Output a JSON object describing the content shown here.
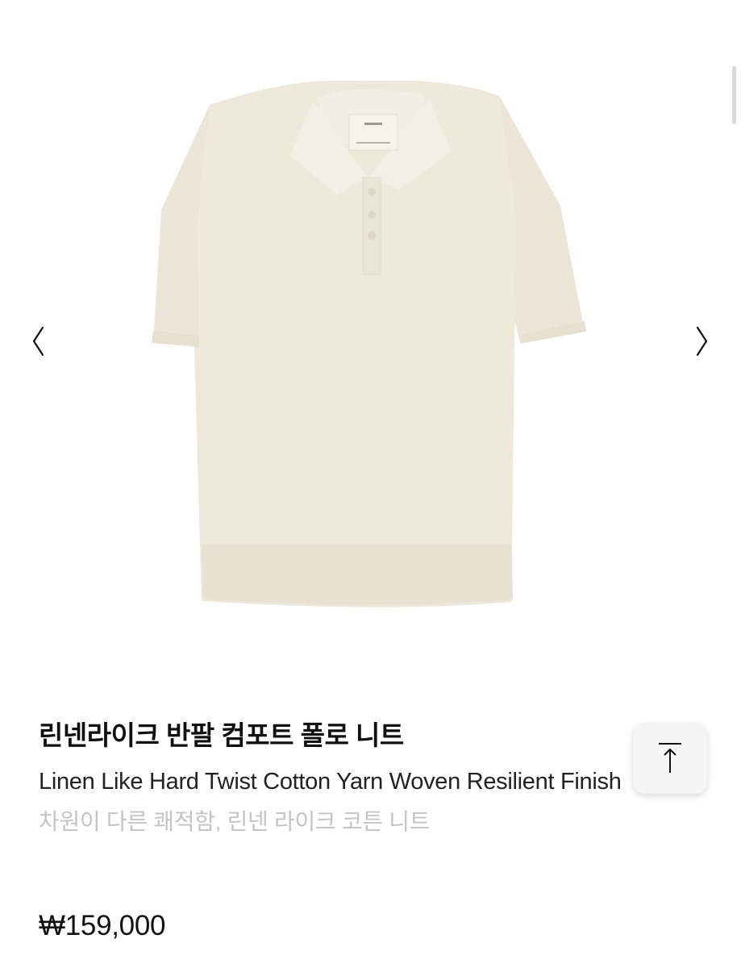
{
  "product": {
    "title_ko": "린넨라이크 반팔 컴포트 폴로 니트",
    "title_en": "Linen Like Hard Twist Cotton Yarn Woven Resilient Finish",
    "subtitle": "차원이 다른 쾌적함, 린넨 라이크 코튼 니트",
    "price": "₩159,000"
  },
  "icons": {
    "prev": "chevron-left-icon",
    "next": "chevron-right-icon",
    "scroll_top": "arrow-up-to-top-icon"
  },
  "colors": {
    "shirt": "#efe9dc",
    "subtitle": "#c4c4c4",
    "button_bg": "#f5f5f5"
  }
}
